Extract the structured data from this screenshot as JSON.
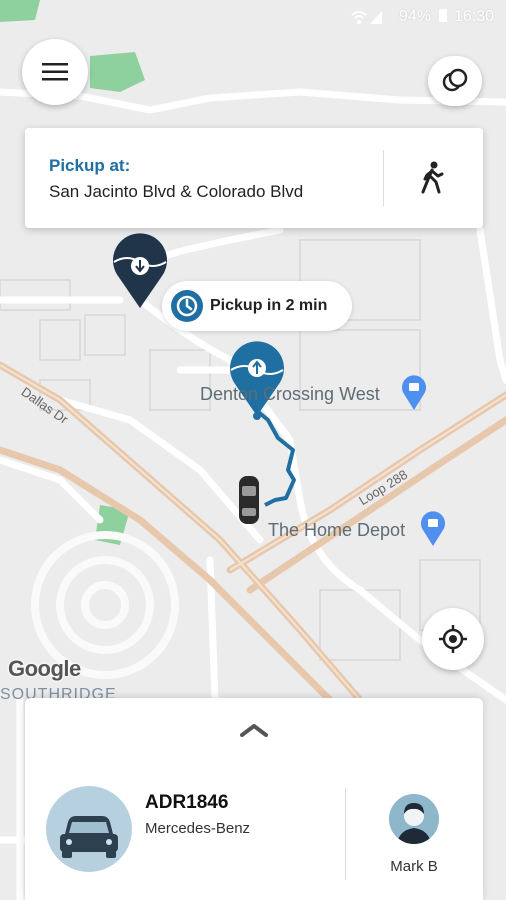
{
  "status_bar": {
    "battery": "94%",
    "time": "16:30"
  },
  "header": {
    "menu_icon": "hamburger-menu-icon",
    "layers_icon": "map-layers-icon"
  },
  "pickup_card": {
    "label": "Pickup at:",
    "address": "San Jacinto Blvd & Colorado Blvd",
    "walk_icon": "walking-person-icon"
  },
  "eta": {
    "text": "Pickup in 2 min",
    "icon": "clock-icon"
  },
  "map": {
    "labels": {
      "denton_crossing": "Denton Crossing West",
      "home_depot": "The Home Depot",
      "dallas_dr": "Dallas Dr",
      "loop": "Loop 288",
      "southridge": "SOUTHRIDGE",
      "google": "Google"
    },
    "colors": {
      "route": "#1f6fa2",
      "pin": "#1f6fa2",
      "dropoff_pin": "#20344a",
      "park": "#8fd19e",
      "highway": "#e7c8ad",
      "place_pin": "#4e8ff0"
    }
  },
  "locate_button": {
    "icon": "my-location-icon"
  },
  "bottom_sheet": {
    "expand_icon": "chevron-up-icon",
    "plate": "ADR1846",
    "car_model": "Mercedes-Benz",
    "driver_name": "Mark B",
    "car_icon": "car-icon",
    "driver_icon": "driver-avatar-icon"
  }
}
